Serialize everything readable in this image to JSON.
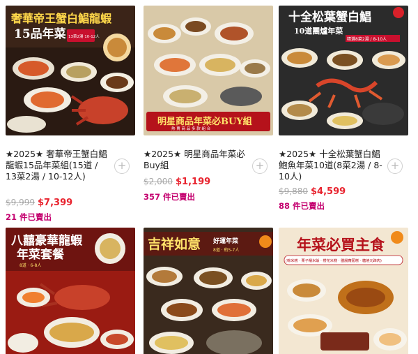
{
  "products": [
    {
      "title": "★2025★ 奢華帝王蟹白鯧龍蝦15品年菜組(15道 / 13菜2湯 / 10-12人)",
      "original_price": "$9,999",
      "sale_price": "$7,399",
      "sold": "21 件已賣出",
      "banner": {
        "line1": "奢華帝王蟹白鯧龍蝦",
        "line2": "15品年菜",
        "badge": "13菜2湯 10-12人"
      },
      "add_label": "+"
    },
    {
      "title": "★2025★ 明星商品年菜必Buy組",
      "original_price": "$2,000",
      "sale_price": "$1,199",
      "sold": "357 件已賣出",
      "banner": {
        "line1": "明星商品年菜必BUY組",
        "line2": "熱 賣 商 品 多 款 組 合"
      },
      "add_label": "+"
    },
    {
      "title": "★2025★ 十全松葉蟹白鯧鮑魚年菜10道(8菜2湯 / 8-10人)",
      "original_price": "$9,880",
      "sale_price": "$4,599",
      "sold": "88 件已賣出",
      "banner": {
        "line1": "十全松葉蟹白鯧",
        "line2": "10道團爐年菜",
        "badge": "精選8菜2湯 / 8-10人"
      },
      "add_label": "+"
    },
    {
      "banner": {
        "line1": "八囍豪華龍蝦",
        "line2": "年菜套餐",
        "badge": "8道 · 6-8人"
      }
    },
    {
      "banner": {
        "line1": "吉祥如意",
        "line2": "好運年菜",
        "badge": "8道 · 約5-7人"
      }
    },
    {
      "banner": {
        "line1": "年菜必買主食",
        "line2": "(粽米糕 · 栗子糯米飯 · 櫻花米糕 · 臘腸蘿蔔糕 · 糖燒元蹄肉)"
      }
    }
  ],
  "colors": {
    "accent_red": "#e8232e",
    "sold_magenta": "#c4006f",
    "strike_gray": "#a8a8a8"
  }
}
